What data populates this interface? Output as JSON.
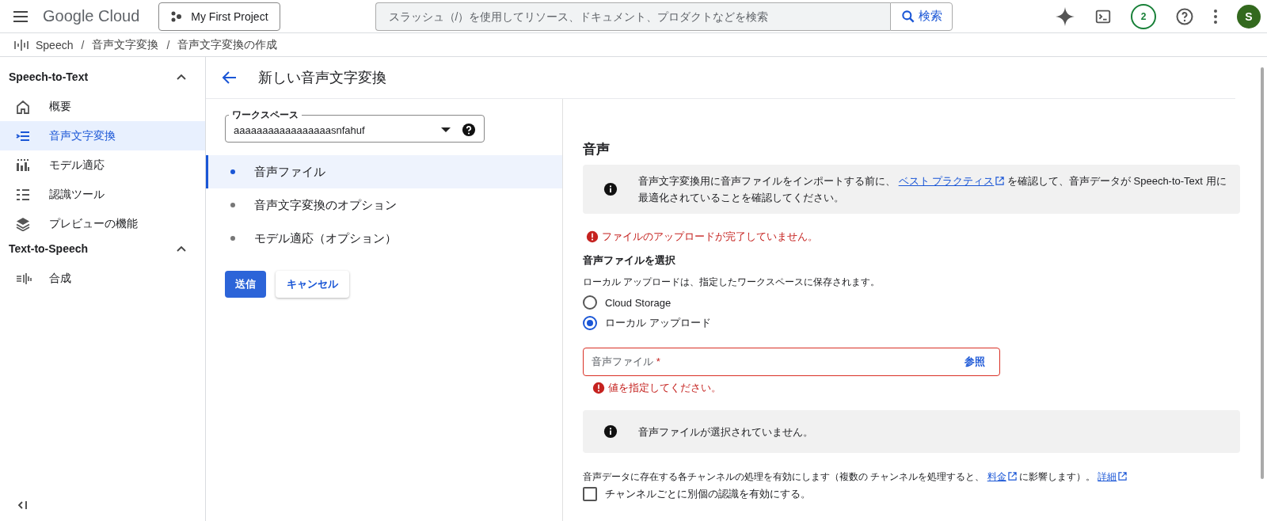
{
  "topbar": {
    "product": "Google Cloud",
    "project": "My First Project",
    "search": {
      "placeholder": "スラッシュ（/）を使用してリソース、ドキュメント、プロダクトなどを検索",
      "button": "検索"
    },
    "notifications": "2",
    "avatar": "S"
  },
  "breadcrumb": [
    {
      "label": "Speech"
    },
    {
      "separator": "/",
      "label": "音声文字変換"
    },
    {
      "separator": "/",
      "label": "音声文字変換の作成"
    }
  ],
  "sidebar": {
    "sections": [
      {
        "title": "Speech-to-Text",
        "expanded": true,
        "items": [
          {
            "label": "概要",
            "selected": false
          },
          {
            "label": "音声文字変換",
            "selected": true
          },
          {
            "label": "モデル適応",
            "selected": false
          },
          {
            "label": "認識ツール",
            "selected": false
          },
          {
            "label": "プレビューの機能",
            "selected": false
          }
        ]
      },
      {
        "title": "Text-to-Speech",
        "expanded": true,
        "items": [
          {
            "label": "合成",
            "selected": false
          }
        ]
      }
    ]
  },
  "page": {
    "title": "新しい音声文字変換"
  },
  "workspace": {
    "label": "ワークスペース",
    "value": "aaaaaaaaaaaaaaaaasnfahuf"
  },
  "steps": [
    {
      "label": "音声ファイル",
      "selected": true
    },
    {
      "label": "音声文字変換のオプション",
      "selected": false
    },
    {
      "label": "モデル適応（オプション）",
      "selected": false
    }
  ],
  "actions": {
    "submit": "送信",
    "cancel": "キャンセル"
  },
  "audio": {
    "heading": "音声",
    "info": {
      "before": "音声文字変換用に音声ファイルをインポートする前に、",
      "link": "ベスト プラクティス",
      "after": "を確認して、音声データが Speech-to-Text 用に最適化されていることを確認してください。"
    },
    "upload_error": "ファイルのアップロードが完了していません。",
    "select_heading": "音声ファイルを選択",
    "select_hint": "ローカル アップロードは、指定したワークスペースに保存されます。",
    "sources": [
      {
        "label": "Cloud Storage",
        "selected": false
      },
      {
        "label": "ローカル アップロード",
        "selected": true
      }
    ],
    "file_field": {
      "label": "音声ファイル",
      "required_mark": "*",
      "browse": "参照",
      "error": "値を指定してください。"
    },
    "no_file_info": "音声ファイルが選択されていません。",
    "channel_text": {
      "before": "音声データに存在する各チャンネルの処理を有効にします（複数の チャンネルを処理すると、",
      "link": "料金",
      "after": "に影響します）。",
      "more": "詳細"
    },
    "channel_checkbox": {
      "label": "チャンネルごとに別個の認識を有効にする。",
      "checked": false
    }
  }
}
